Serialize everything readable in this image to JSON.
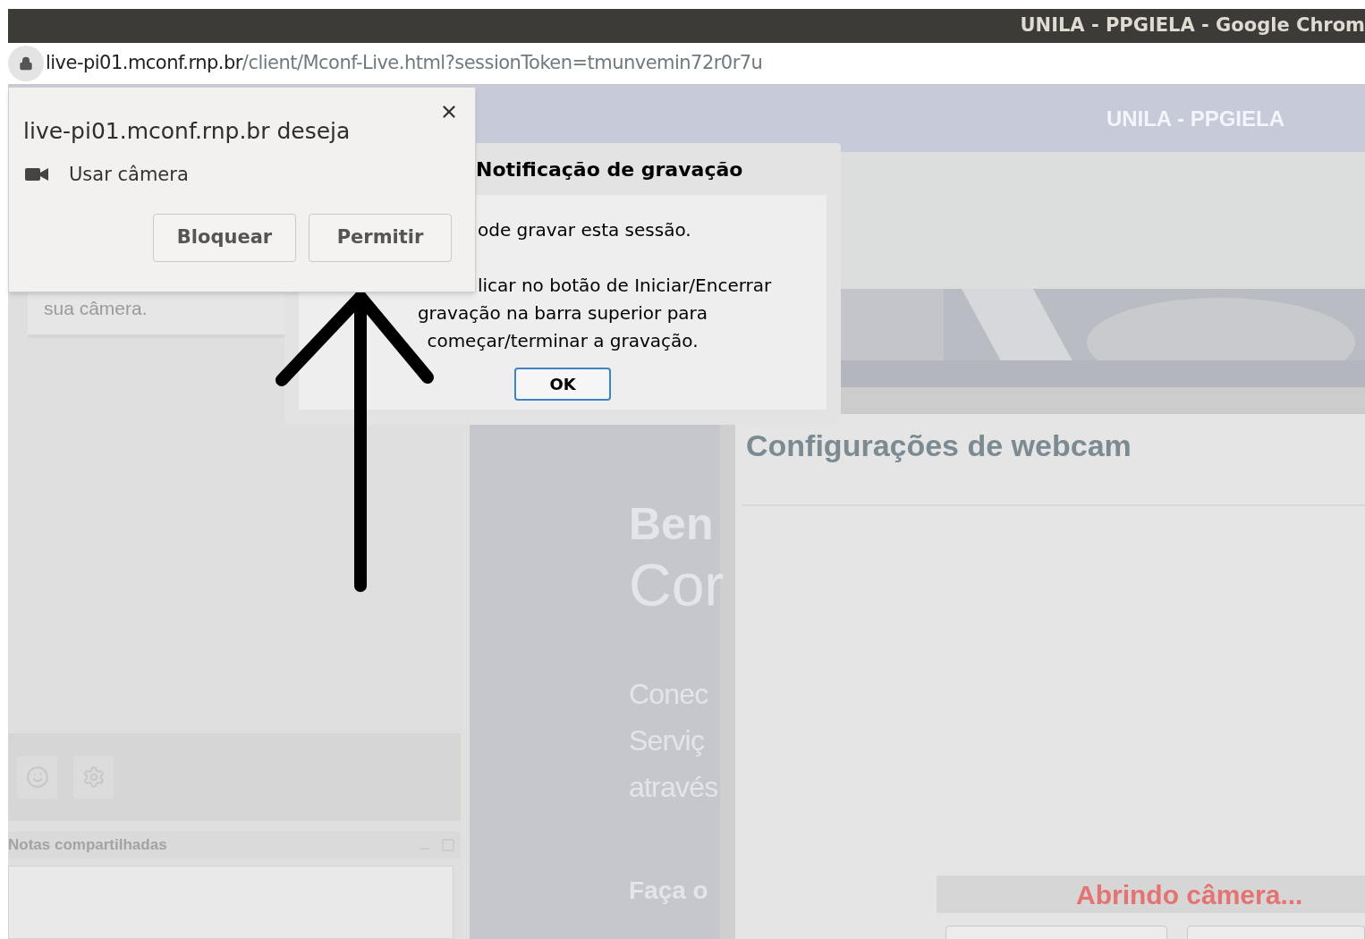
{
  "window": {
    "title": "UNILA - PPGIELA - Google Chrom"
  },
  "address_bar": {
    "host": "live-pi01.mconf.rnp.br",
    "path": "/client/Mconf-Live.html?sessionToken=tmunvemin72r0r7u"
  },
  "app_header": {
    "title": "UNILA - PPGIELA"
  },
  "left_panel": {
    "card_text": "sua câmera.",
    "toolbar": [
      {
        "kind": "emoji"
      },
      {
        "kind": "settings"
      }
    ]
  },
  "notes_panel": {
    "title": "Notas compartilhadas"
  },
  "welcome_banner": {
    "lines": [
      {
        "text": "Ben",
        "kind": "heading"
      },
      {
        "text": "Cor",
        "kind": "subheading"
      },
      {
        "text": "Conec",
        "kind": "body"
      },
      {
        "text": "Serviç",
        "kind": "body"
      },
      {
        "text": "através",
        "kind": "body"
      },
      {
        "text": "Faça o",
        "kind": "cta"
      }
    ]
  },
  "webcam_settings": {
    "title": "Configurações de webcam",
    "status": "Abrindo câmera..."
  },
  "recording_dialog": {
    "title": "Notificação de gravação",
    "cut_lines": [
      "ode gravar esta sessão.",
      "licar no botão de Iniciar/Encerrar"
    ],
    "lines": [
      "gravação na barra superior para",
      "começar/terminar a gravação."
    ],
    "ok_button": "OK"
  },
  "permission_prompt": {
    "title": "live-pi01.mconf.rnp.br deseja",
    "permission": "Usar câmera",
    "buttons": [
      "Bloquear",
      "Permitir"
    ]
  }
}
